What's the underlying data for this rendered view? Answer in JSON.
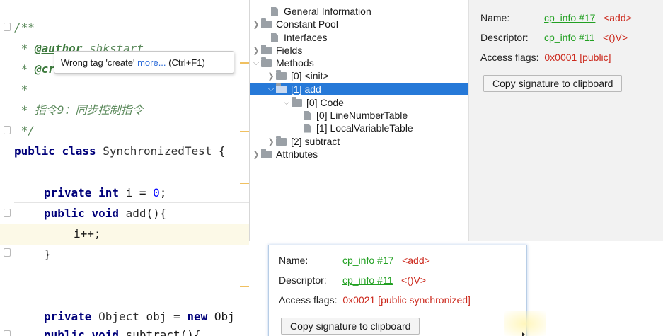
{
  "editor": {
    "lines": {
      "doc_open": "/**",
      "author_prefix": " * ",
      "author_tag": "@author",
      "author_value": " shkstart",
      "create_prefix": " * ",
      "create_tag": "@cr",
      "star": " *",
      "instr_prefix": " * ",
      "instr_text": "指令9：同步控制指令",
      "doc_close": " */",
      "class_kw1": "public",
      "class_kw2": "class",
      "class_name": "SynchronizedTest",
      "class_brace": " {",
      "field_kw1": "private",
      "field_kw2": "int",
      "field_name": " i",
      "field_eq": " = ",
      "field_val": "0",
      "field_semi": ";",
      "method_kw1": "public",
      "method_kw2": "void",
      "method_name": " add",
      "method_rest": "(){",
      "body_stmt": "i++;",
      "close_brace": "}",
      "obj_kw": "private",
      "obj_type": " Object",
      "obj_name": " obj",
      "obj_eq": " = ",
      "obj_new": "new",
      "obj_rest": " Obj",
      "cut_kw1": "public",
      "cut_kw2": "void",
      "cut_name": " subtract(){"
    },
    "tooltip": {
      "text": "Wrong tag 'create'",
      "link": "more...",
      "shortcut": "(Ctrl+F1)"
    }
  },
  "tree": {
    "items": [
      {
        "label": "General Information"
      },
      {
        "label": "Constant Pool"
      },
      {
        "label": "Interfaces"
      },
      {
        "label": "Fields"
      },
      {
        "label": "Methods"
      },
      {
        "label": "[0] <init>"
      },
      {
        "label": "[1] add"
      },
      {
        "label": "[0] Code"
      },
      {
        "label": "[0] LineNumberTable"
      },
      {
        "label": "[1] LocalVariableTable"
      },
      {
        "label": "[2] subtract"
      },
      {
        "label": "Attributes"
      }
    ]
  },
  "info": {
    "name_label": "Name:",
    "name_link": "cp_info #17",
    "name_value": "<add>",
    "descriptor_label": "Descriptor:",
    "descriptor_link": "cp_info #11",
    "descriptor_value": "<()V>",
    "flags_label": "Access flags:",
    "flags_value": "0x0001 [public]",
    "copy_button": "Copy signature to clipboard"
  },
  "popup": {
    "name_label": "Name:",
    "name_link": "cp_info #17",
    "name_value": "<add>",
    "descriptor_label": "Descriptor:",
    "descriptor_link": "cp_info #11",
    "descriptor_value": "<()V>",
    "flags_label": "Access flags:",
    "flags_value": "0x0021 [public synchronized]",
    "copy_button": "Copy signature to clipboard"
  },
  "colors": {
    "selection": "#2679d8",
    "link": "#22a022",
    "value": "#cc2a1e",
    "keyword": "#00007a",
    "comment": "#5c8a5c"
  }
}
